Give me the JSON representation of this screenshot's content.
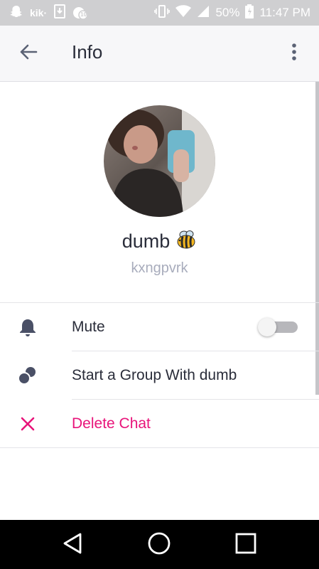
{
  "status_bar": {
    "left_icons": [
      "snapchat-icon",
      "kik-icon",
      "download-icon",
      "notification-badge-icon"
    ],
    "kik_label": "kik·",
    "badge_count": "10",
    "right_icons": [
      "vibrate-icon",
      "wifi-icon",
      "signal-icon",
      "battery-icon"
    ],
    "battery": "50%",
    "time": "11:47 PM"
  },
  "app_bar": {
    "back_icon": "arrow-left-icon",
    "title": "Info",
    "menu_icon": "more-vertical-icon"
  },
  "profile": {
    "display_name": "dumb",
    "emoji": "🐝",
    "username": "kxngpvrk"
  },
  "actions": [
    {
      "icon": "bell-icon",
      "label": "Mute",
      "toggle": false
    },
    {
      "icon": "group-icon",
      "label": "Start a Group With dumb"
    },
    {
      "icon": "x-icon",
      "label": "Delete Chat"
    }
  ],
  "colors": {
    "danger": "#e8147a",
    "text": "#2a2d3a",
    "muted": "#a8acbc",
    "status_bar": "#cfcfd1"
  },
  "nav_bar": [
    "back-triangle-icon",
    "home-circle-icon",
    "recents-square-icon"
  ]
}
